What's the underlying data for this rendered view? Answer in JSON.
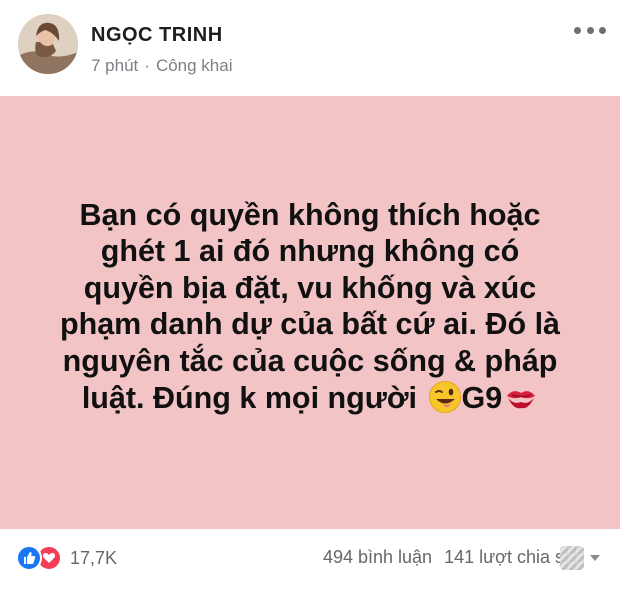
{
  "post": {
    "author": "NGỌC TRINH",
    "time": "7 phút",
    "separator": "·",
    "privacy": "Công khai",
    "status_lines": [
      "Bạn có quyền không thích hoặc",
      "ghét 1 ai đó nhưng không có",
      "quyền bịa đặt, vu khống và xúc",
      "phạm danh dự của bất cứ ai. Đó là",
      "nguyên tắc của cuộc sống & pháp",
      "luật. Đúng k mọi người",
      "G9"
    ],
    "background_color": "#f2c4c5",
    "emojis": [
      "winking-tongue-face-emoji",
      "kiss-mark-emoji"
    ]
  },
  "engagement": {
    "reaction_count": "17,7K",
    "comments": "494 bình luận",
    "shares": "141 lượt chia sẻ",
    "reaction_icons": [
      "like-icon",
      "love-icon"
    ],
    "like_color": "#1877f2",
    "love_color": "#f33e58"
  }
}
